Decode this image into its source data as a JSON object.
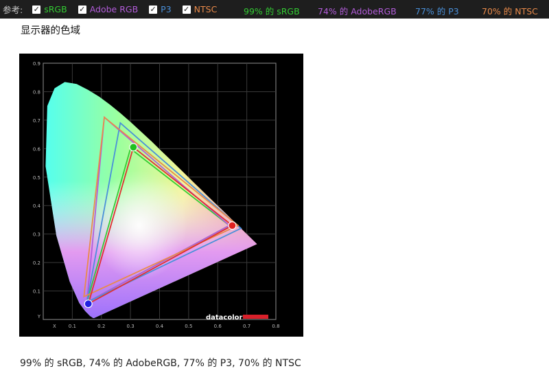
{
  "topbar": {
    "ref_label": "参考:",
    "checkboxes": [
      {
        "label": "sRGB",
        "color": "#33cc33",
        "checked": true
      },
      {
        "label": "Adobe RGB",
        "color": "#b25cd9",
        "checked": true
      },
      {
        "label": "P3",
        "color": "#4a90d9",
        "checked": true
      },
      {
        "label": "NTSC",
        "color": "#e98a4a",
        "checked": true
      }
    ],
    "stats": [
      {
        "text": "99% 的 sRGB",
        "color": "#33cc33"
      },
      {
        "text": "74% 的 AdobeRGB",
        "color": "#b25cd9"
      },
      {
        "text": "77% 的 P3",
        "color": "#4a90d9"
      },
      {
        "text": "70% 的 NTSC",
        "color": "#e98a4a"
      }
    ]
  },
  "heading": "显示器的色域",
  "caption": "99% 的 sRGB, 74% 的 AdobeRGB, 77% 的 P3, 70% 的 NTSC",
  "chart_data": {
    "type": "scatter",
    "xlabel": "x",
    "ylabel": "y",
    "xlim": [
      0,
      0.8
    ],
    "ylim": [
      0,
      0.9
    ],
    "x_ticks": [
      "0.1",
      "0.2",
      "0.3",
      "0.4",
      "0.5",
      "0.6",
      "0.7",
      "0.8"
    ],
    "y_ticks": [
      "0.1",
      "0.2",
      "0.3",
      "0.4",
      "0.5",
      "0.6",
      "0.7",
      "0.8",
      "0.9"
    ],
    "x_axis_letter": "X",
    "y_axis_letter": "Y",
    "grid": true,
    "watermark": "datacolor",
    "triangles": [
      {
        "name": "sRGB",
        "color": "#33cc33",
        "points": [
          [
            0.64,
            0.33
          ],
          [
            0.3,
            0.6
          ],
          [
            0.15,
            0.06
          ]
        ]
      },
      {
        "name": "Adobe RGB",
        "color": "#b25cd9",
        "points": [
          [
            0.64,
            0.33
          ],
          [
            0.21,
            0.71
          ],
          [
            0.15,
            0.06
          ]
        ]
      },
      {
        "name": "P3",
        "color": "#4a90d9",
        "points": [
          [
            0.68,
            0.32
          ],
          [
            0.265,
            0.69
          ],
          [
            0.15,
            0.06
          ]
        ]
      },
      {
        "name": "NTSC",
        "color": "#e98a4a",
        "points": [
          [
            0.67,
            0.33
          ],
          [
            0.21,
            0.71
          ],
          [
            0.14,
            0.08
          ]
        ]
      },
      {
        "name": "Display",
        "color": "#e03030",
        "points": [
          [
            0.65,
            0.33
          ],
          [
            0.31,
            0.605
          ],
          [
            0.155,
            0.055
          ]
        ]
      }
    ],
    "primaries": [
      {
        "name": "red",
        "x": 0.65,
        "y": 0.33,
        "color": "#e02020"
      },
      {
        "name": "green",
        "x": 0.31,
        "y": 0.605,
        "color": "#20c020"
      },
      {
        "name": "blue",
        "x": 0.155,
        "y": 0.055,
        "color": "#2020e0"
      }
    ],
    "locus": [
      [
        0.175,
        0.005
      ],
      [
        0.174,
        0.005
      ],
      [
        0.173,
        0.005
      ],
      [
        0.171,
        0.005
      ],
      [
        0.166,
        0.009
      ],
      [
        0.161,
        0.012
      ],
      [
        0.144,
        0.03
      ],
      [
        0.124,
        0.058
      ],
      [
        0.091,
        0.133
      ],
      [
        0.045,
        0.295
      ],
      [
        0.008,
        0.538
      ],
      [
        0.014,
        0.75
      ],
      [
        0.039,
        0.812
      ],
      [
        0.074,
        0.834
      ],
      [
        0.115,
        0.827
      ],
      [
        0.155,
        0.806
      ],
      [
        0.193,
        0.782
      ],
      [
        0.23,
        0.754
      ],
      [
        0.266,
        0.724
      ],
      [
        0.302,
        0.692
      ],
      [
        0.337,
        0.659
      ],
      [
        0.373,
        0.625
      ],
      [
        0.408,
        0.59
      ],
      [
        0.444,
        0.555
      ],
      [
        0.479,
        0.52
      ],
      [
        0.512,
        0.487
      ],
      [
        0.575,
        0.424
      ],
      [
        0.627,
        0.373
      ],
      [
        0.666,
        0.334
      ],
      [
        0.692,
        0.308
      ],
      [
        0.735,
        0.265
      ]
    ]
  }
}
